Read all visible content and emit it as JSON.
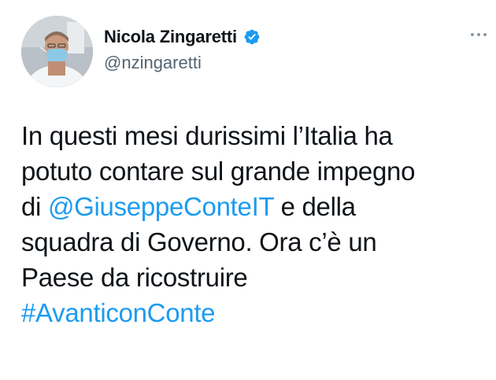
{
  "tweet": {
    "display_name": "Nicola Zingaretti",
    "handle": "@nzingaretti",
    "verified": true,
    "line1": "In questi mesi durissimi l’Italia ha",
    "line2": "potuto contare sul grande impegno",
    "line3_pre": "di ",
    "mention": "@GiuseppeConteIT",
    "line3_post": " e della",
    "line4": "squadra di Governo. Ora c’è un",
    "line5": "Paese da ricostruire",
    "hashtag": "#AvanticonConte"
  },
  "colors": {
    "link": "#1d9bf0",
    "text": "#0f1419",
    "secondary": "#536471"
  },
  "icons": {
    "verified": "verified-badge-icon",
    "more": "more-options-icon"
  }
}
